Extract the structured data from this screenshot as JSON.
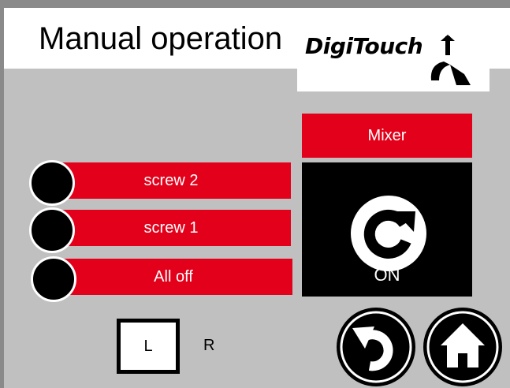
{
  "header": {
    "title": "Manual operation",
    "logo_text": "DigiTouch"
  },
  "mixer": {
    "label": "Mixer",
    "state": "ON",
    "icon": "rotate-icon"
  },
  "switches": [
    {
      "label": "screw 2"
    },
    {
      "label": "screw 1"
    },
    {
      "label": "All off"
    }
  ],
  "direction": {
    "left_label": "L",
    "right_label": "R"
  },
  "nav": {
    "back_icon": "back-arrow-icon",
    "home_icon": "home-icon"
  },
  "colors": {
    "accent": "#e2001a",
    "panel_bg": "#c0c0c0",
    "header_bg": "#ffffff",
    "dark": "#000000"
  }
}
